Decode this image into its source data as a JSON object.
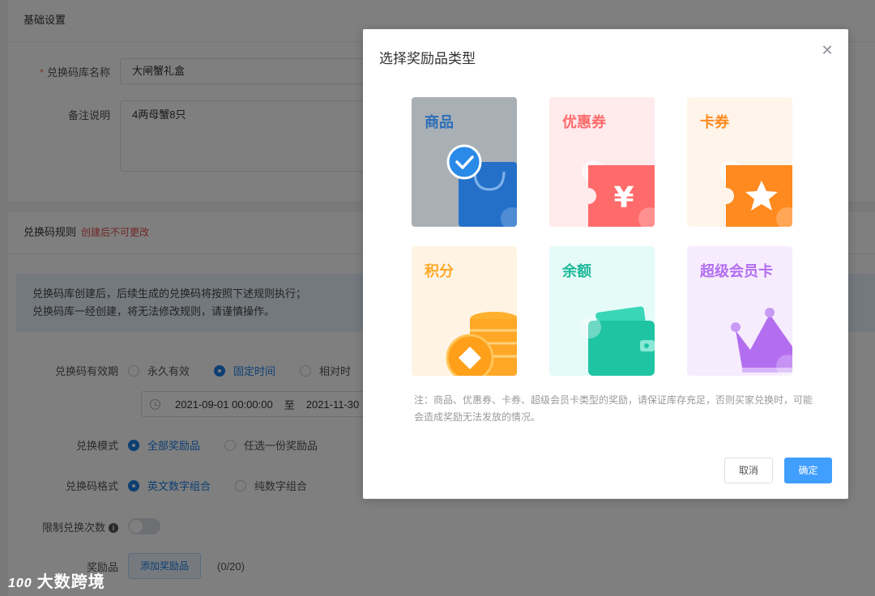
{
  "basic": {
    "section_title": "基础设置",
    "name_label": "兑换码库名称",
    "name_value": "大闸蟹礼盒",
    "remark_label": "备注说明",
    "remark_value": "4两母蟹8只"
  },
  "rules": {
    "section_title": "兑换码规则",
    "warning": "创建后不可更改",
    "notice_line1": "兑换码库创建后，后续生成的兑换码将按照下述规则执行；",
    "notice_line2": "兑换码库一经创建，将无法修改规则，请谨慎操作。",
    "validity_label": "兑换码有效期",
    "validity_options": [
      "永久有效",
      "固定时间",
      "相对时"
    ],
    "date_start": "2021-09-01 00:00:00",
    "date_sep": "至",
    "date_end": "2021-11-30",
    "mode_label": "兑换模式",
    "mode_options": [
      "全部奖励品",
      "任选一份奖励品"
    ],
    "format_label": "兑换码格式",
    "format_options": [
      "英文数字组合",
      "纯数字组合"
    ],
    "limit_label": "限制兑换次数",
    "prize_label": "奖励品",
    "add_prize_button": "添加奖励品",
    "prize_count": "(0/20)"
  },
  "watermark": {
    "logo": "100",
    "text": "大数跨境"
  },
  "dialog": {
    "title": "选择奖励品类型",
    "tiles": [
      {
        "label": "商品",
        "color": "#2e6fb8",
        "selected": true
      },
      {
        "label": "优惠券",
        "color": "#ff6b6b"
      },
      {
        "label": "卡券",
        "color": "#ff8a1f"
      },
      {
        "label": "积分",
        "color": "#ffa726"
      },
      {
        "label": "余额",
        "color": "#1fb89a"
      },
      {
        "label": "超级会员卡",
        "color": "#b36ef0"
      }
    ],
    "note": "注：商品、优惠券、卡券、超级会员卡类型的奖励，请保证库存充足，否则买家兑换时，可能会造成奖励无法发放的情况。",
    "cancel": "取消",
    "confirm": "确定"
  }
}
